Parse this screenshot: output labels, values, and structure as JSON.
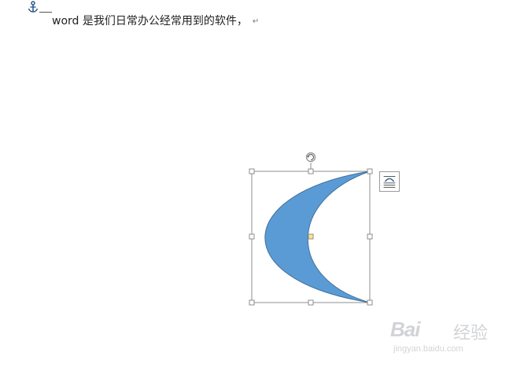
{
  "document": {
    "line_text": "word 是我们日常办公经常用到的软件，",
    "paragraph_mark": "↵"
  },
  "shape": {
    "type": "moon",
    "fill": "#5b9bd5",
    "outline": "#41719c",
    "handle_adjust_color": "#ffe38a",
    "selected": true
  },
  "watermark": {
    "brand": "Bai",
    "suffix": "经验",
    "url": "jingyan.baidu.com"
  },
  "icons": {
    "anchor": "anchor-icon",
    "rotate": "rotate-handle-icon",
    "layout_options": "layout-options-icon"
  }
}
